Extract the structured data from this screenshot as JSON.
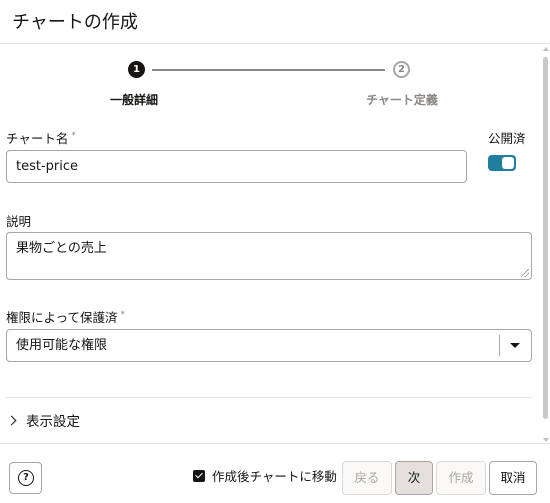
{
  "dialog": {
    "title": "チャートの作成"
  },
  "stepper": {
    "steps": [
      {
        "number": "1",
        "label": "一般詳細"
      },
      {
        "number": "2",
        "label": "チャート定義"
      }
    ]
  },
  "form": {
    "chart_name": {
      "label": "チャート名",
      "required_mark": "*",
      "value": "test-price"
    },
    "published": {
      "label": "公開済",
      "on": true
    },
    "description": {
      "label": "説明",
      "value": "果物ごとの売上"
    },
    "permission": {
      "label": "権限によって保護済",
      "required_mark": "*",
      "selected": "使用可能な権限"
    }
  },
  "section": {
    "display_settings": "表示設定"
  },
  "footer": {
    "help": "?",
    "move_after_create": {
      "label": "作成後チャートに移動",
      "checked": true
    },
    "back_label": "戻る",
    "next_label": "次",
    "create_label": "作成",
    "cancel_label": "取消"
  },
  "colors": {
    "accent": "#227e9e",
    "text": "#161513",
    "muted": "#8a8784"
  }
}
